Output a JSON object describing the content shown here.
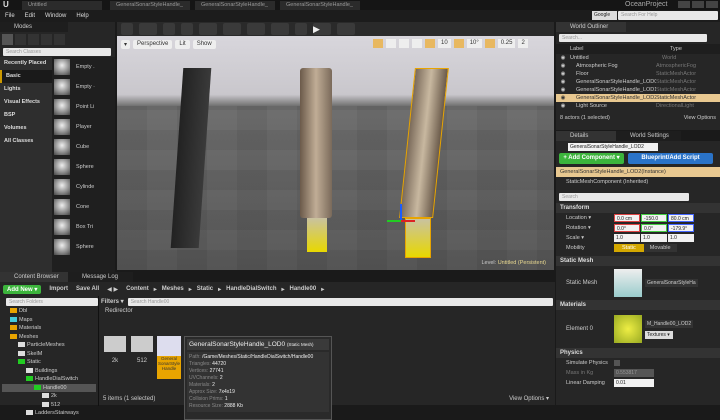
{
  "window": {
    "tabs": [
      "Untitled",
      "GeneralSonarStyleHandle_",
      "GeneralSonarStyleHandle_",
      "GeneralSonarStyleHandle_"
    ],
    "project": "OceanProject",
    "search_provider": "Google",
    "search_help_placeholder": "Search For Help"
  },
  "menu": [
    "File",
    "Edit",
    "Window",
    "Help"
  ],
  "modes": {
    "title": "Modes",
    "search_placeholder": "Search Classes",
    "categories": [
      "Recently Placed",
      "Basic",
      "Lights",
      "Visual Effects",
      "BSP",
      "Volumes",
      "All Classes"
    ],
    "selected_category": "Basic",
    "items": [
      "Empty .",
      "Empty ·",
      "Point Li",
      "Player",
      "Cube",
      "Sphere",
      "Cylinde",
      "Cone",
      "Box Tri",
      "Sphere"
    ]
  },
  "viewport": {
    "perspective": "Perspective",
    "lit": "Lit",
    "show": "Show",
    "grid_snap": "10",
    "rot_snap": "10°",
    "scale_snap": "0.25",
    "camera_speed": "2",
    "level": "Level:",
    "level_name": "Untitled (Persistent)"
  },
  "outliner": {
    "title": "World Outliner",
    "search_placeholder": "Search...",
    "col_label": "Label",
    "col_type": "Type",
    "rows": [
      {
        "label": "Untitled",
        "type": "World"
      },
      {
        "label": "Atmospheric Fog",
        "type": "AtmosphericFog"
      },
      {
        "label": "Floor",
        "type": "StaticMeshActor"
      },
      {
        "label": "GeneralSonarStyleHandle_LOD0",
        "type": "StaticMeshActor"
      },
      {
        "label": "GeneralSonarStyleHandle_LOD1",
        "type": "StaticMeshActor"
      },
      {
        "label": "GeneralSonarStyleHandle_LOD2",
        "type": "StaticMeshActor"
      },
      {
        "label": "Light Source",
        "type": "DirectionalLight"
      }
    ],
    "selected": 5,
    "count": "8 actors (1 selected)",
    "view_options": "View Options"
  },
  "details": {
    "tab": "Details",
    "tab2": "World Settings",
    "name": "GeneralSonarStyleHandle_LOD2",
    "add_component": "+ Add Component ▾",
    "blueprint": "Blueprint/Add Script",
    "instance": "GeneralSonarStyleHandle_LOD2(Instance)",
    "component": "StaticMeshComponent (Inherited)",
    "search_placeholder": "Search",
    "transform": {
      "title": "Transform",
      "location_label": "Location ▾",
      "location": [
        "0.0 cm",
        "-150.0 cm",
        "80.0 cm"
      ],
      "rotation_label": "Rotation ▾",
      "rotation": [
        "0.0°",
        "0.0°",
        "-179.9°"
      ],
      "scale_label": "Scale ▾",
      "scale": [
        "1.0",
        "1.0",
        "1.0"
      ],
      "mobility_label": "Mobility",
      "static": "Static",
      "movable": "Movable"
    },
    "static_mesh": {
      "title": "Static Mesh",
      "label": "Static Mesh",
      "value": "GeneralSonarStyleHa"
    },
    "materials": {
      "title": "Materials",
      "label": "Element 0",
      "value": "M_Handle00_LOD2",
      "textures": "Textures ▾"
    },
    "physics": {
      "title": "Physics",
      "simulate": "Simulate Physics",
      "mass": "Mass in Kg",
      "mass_value": "0.553817",
      "linear_damping": "Linear Damping",
      "linear_damping_value": "0.01"
    }
  },
  "content_browser": {
    "tab": "Content Browser",
    "tab2": "Message Log",
    "add_new": "Add New ▾",
    "import": "Import",
    "save_all": "Save All",
    "breadcrumb": [
      "Content",
      "Meshes",
      "Static",
      "HandleDialSwitch",
      "Handle00"
    ],
    "folder_search": "Search Folders",
    "filters": "Filters ▾",
    "asset_search": "Search Handle00",
    "redirector": "Redirector",
    "folders": [
      {
        "name": "Dbl",
        "d": 1
      },
      {
        "name": "Maps",
        "d": 1
      },
      {
        "name": "Materials",
        "d": 1
      },
      {
        "name": "Meshes",
        "d": 1
      },
      {
        "name": "ParticleMeshes",
        "d": 2
      },
      {
        "name": "SkelM",
        "d": 2
      },
      {
        "name": "Static",
        "d": 2
      },
      {
        "name": "Buildings",
        "d": 3
      },
      {
        "name": "HandleDialSwitch",
        "d": 3
      },
      {
        "name": "Handle00",
        "d": 4
      },
      {
        "name": "2k",
        "d": 5
      },
      {
        "name": "512",
        "d": 5
      },
      {
        "name": "LaddersStairways",
        "d": 3
      }
    ],
    "assets": [
      "2k",
      "512",
      "General SonarStyle Handle"
    ],
    "item_count": "5 items (1 selected)",
    "view_options": "View Options ▾",
    "tooltip": {
      "title": "GeneralSonarStyleHandle_LOD0",
      "kind": "(Static Mesh)",
      "rows": [
        {
          "k": "Path:",
          "v": "/Game/Meshes/Static/HandleDialSwitch/Handle00"
        },
        {
          "k": "Triangles:",
          "v": "44720"
        },
        {
          "k": "Vertices:",
          "v": "27741"
        },
        {
          "k": "UVChannels:",
          "v": "2"
        },
        {
          "k": "Materials:",
          "v": "2"
        },
        {
          "k": "Approx Size:",
          "v": "7x4x19"
        },
        {
          "k": "Collision Prims:",
          "v": "1"
        },
        {
          "k": "Resource Size:",
          "v": "2888 Kb"
        }
      ]
    }
  }
}
